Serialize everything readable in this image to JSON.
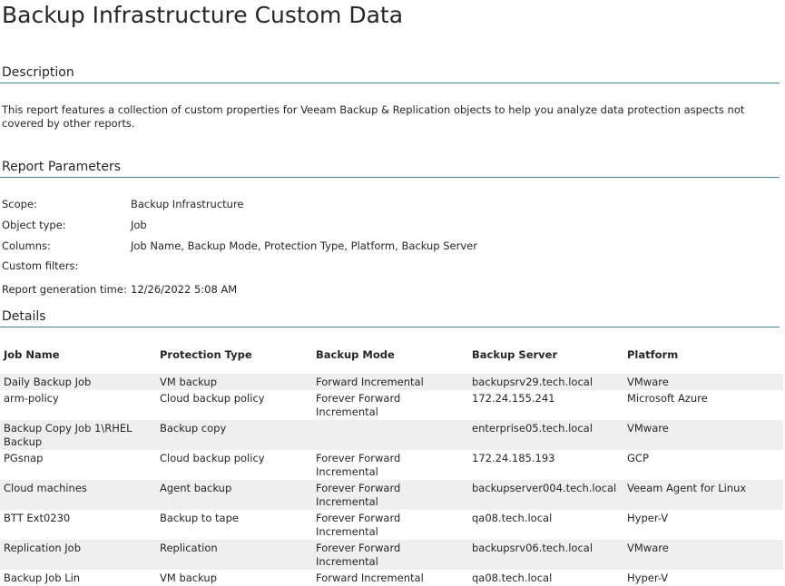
{
  "title": "Backup Infrastructure Custom Data",
  "description": {
    "heading": "Description",
    "text": "This report features a collection of custom properties for Veeam Backup & Replication objects to help you analyze data protection aspects not covered by other reports."
  },
  "parameters": {
    "heading": "Report Parameters",
    "rows": [
      {
        "label": "Scope:",
        "value": "Backup Infrastructure"
      },
      {
        "label": "Object type:",
        "value": "Job"
      },
      {
        "label": "Columns:",
        "value": "Job Name, Backup Mode, Protection Type, Platform, Backup Server"
      },
      {
        "label": "Custom filters:",
        "value": ""
      },
      {
        "label": "Report generation time:",
        "value": "12/26/2022 5:08 AM"
      }
    ]
  },
  "details": {
    "heading": "Details",
    "columns": [
      "Job Name",
      "Protection Type",
      "Backup Mode",
      "Backup Server",
      "Platform"
    ],
    "rows": [
      [
        "Daily Backup Job",
        "VM backup",
        "Forward Incremental",
        "backupsrv29.tech.local",
        "VMware"
      ],
      [
        "arm-policy",
        "Cloud backup policy",
        "Forever Forward Incremental",
        "172.24.155.241",
        "Microsoft Azure"
      ],
      [
        "Backup Copy Job 1\\RHEL Backup",
        "Backup copy",
        "",
        "enterprise05.tech.local",
        "VMware"
      ],
      [
        "PGsnap",
        "Cloud backup policy",
        "Forever Forward Incremental",
        "172.24.185.193",
        "GCP"
      ],
      [
        "Cloud machines",
        "Agent backup",
        "Forever Forward Incremental",
        "backupserver004.tech.local",
        "Veeam Agent for Linux"
      ],
      [
        "BTT Ext0230",
        "Backup to tape",
        "Forever Forward Incremental",
        "qa08.tech.local",
        "Hyper-V"
      ],
      [
        "Replication Job",
        "Replication",
        "Forever Forward Incremental",
        "backupsrv06.tech.local",
        "VMware"
      ],
      [
        "Backup Job Lin",
        "VM backup",
        "Forward Incremental",
        "qa08.tech.local",
        "Hyper-V"
      ]
    ]
  }
}
